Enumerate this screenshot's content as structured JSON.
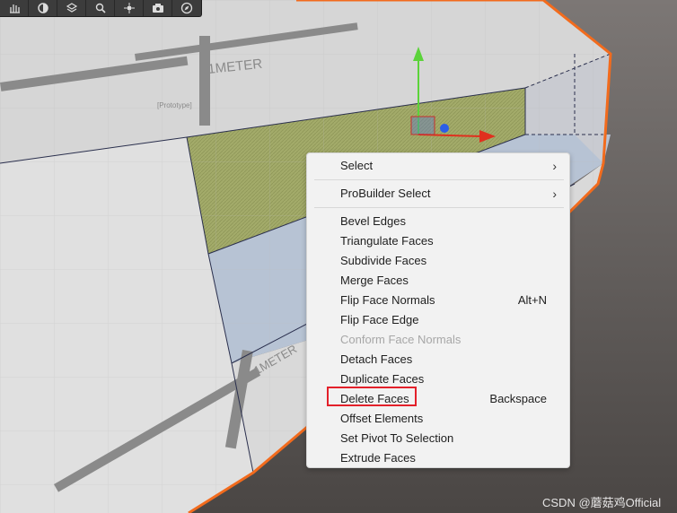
{
  "toolbar": {
    "buttons": [
      {
        "icon": "hand-tool-icon"
      },
      {
        "icon": "sphere-icon"
      },
      {
        "icon": "layers-icon"
      },
      {
        "icon": "search-icon"
      },
      {
        "icon": "move-gizmo-icon"
      },
      {
        "icon": "camera-icon"
      },
      {
        "icon": "compass-icon"
      }
    ]
  },
  "scene": {
    "floor_color": "#4f4b48",
    "selection_outline_color": "#f26b1d",
    "selected_face_color": "#a3ab6a",
    "prototype_labels": [
      "1METER",
      "1METER",
      "[Prototype]",
      "[Prototype]"
    ]
  },
  "context_menu": {
    "items": [
      {
        "label": "Select",
        "has_submenu": true,
        "shortcut": ""
      },
      {
        "label": "ProBuilder Select",
        "has_submenu": true,
        "shortcut": ""
      },
      {
        "label": "Bevel Edges",
        "shortcut": ""
      },
      {
        "label": "Triangulate Faces",
        "shortcut": ""
      },
      {
        "label": "Subdivide Faces",
        "shortcut": ""
      },
      {
        "label": "Merge Faces",
        "shortcut": ""
      },
      {
        "label": "Flip Face Normals",
        "shortcut": "Alt+N"
      },
      {
        "label": "Flip Face Edge",
        "shortcut": ""
      },
      {
        "label": "Conform Face Normals",
        "shortcut": "",
        "disabled": true
      },
      {
        "label": "Detach Faces",
        "shortcut": ""
      },
      {
        "label": "Duplicate Faces",
        "shortcut": ""
      },
      {
        "label": "Delete Faces",
        "shortcut": "Backspace",
        "highlighted": true
      },
      {
        "label": "Offset Elements",
        "shortcut": ""
      },
      {
        "label": "Set Pivot To Selection",
        "shortcut": ""
      },
      {
        "label": "Extrude Faces",
        "shortcut": ""
      }
    ],
    "submenu_glyph": "›",
    "highlight_color": "#e3202a"
  },
  "watermark": "CSDN @蘑菇鸡Official"
}
